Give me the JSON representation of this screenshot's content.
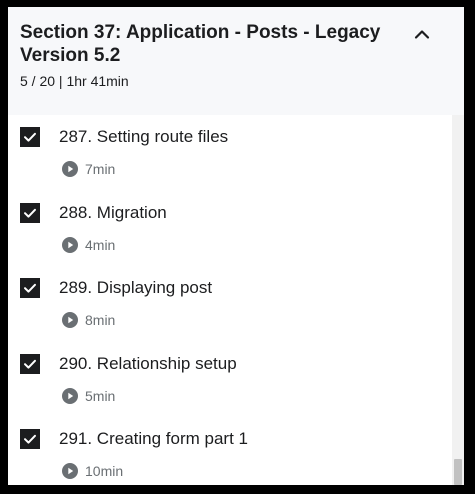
{
  "section": {
    "title": "Section 37: Application - Posts - Legacy Version 5.2",
    "progress": "5 / 20 | 1hr 41min",
    "collapse_icon": "chevron-up-icon"
  },
  "items": [
    {
      "title": "287. Setting route files",
      "duration": "7min",
      "completed": true
    },
    {
      "title": "288. Migration",
      "duration": "4min",
      "completed": true
    },
    {
      "title": "289. Displaying post",
      "duration": "8min",
      "completed": true
    },
    {
      "title": "290. Relationship setup",
      "duration": "5min",
      "completed": true
    },
    {
      "title": "291. Creating form part 1",
      "duration": "10min",
      "completed": true
    }
  ],
  "colors": {
    "text": "#1c1d1f",
    "muted": "#6a6f73",
    "header_bg": "#f7f8fa",
    "checkbox_bg": "#1c1d1f"
  }
}
